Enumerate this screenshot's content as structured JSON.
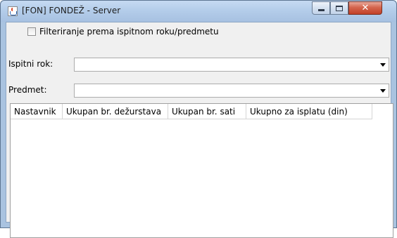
{
  "window": {
    "title": "[FON] FONDEŽ - Server",
    "icon": "java-cup-icon",
    "buttons": [
      "minimize",
      "maximize",
      "close"
    ]
  },
  "filter": {
    "checkbox_label": "Filteriranje prema ispitnom roku/predmetu",
    "checked": false
  },
  "fields": {
    "ispitni_rok_label": "Ispitni rok:",
    "ispitni_rok_value": "",
    "predmet_label": "Predmet:",
    "predmet_value": ""
  },
  "table": {
    "columns": [
      "Nastavnik",
      "Ukupan br. dežurstava",
      "Ukupan br. sati",
      "Ukupno za isplatu (din)"
    ],
    "rows": []
  },
  "colors": {
    "titlebar": "#b4cdea",
    "close_button": "#c24128",
    "content_bg": "#f0f0f0"
  }
}
